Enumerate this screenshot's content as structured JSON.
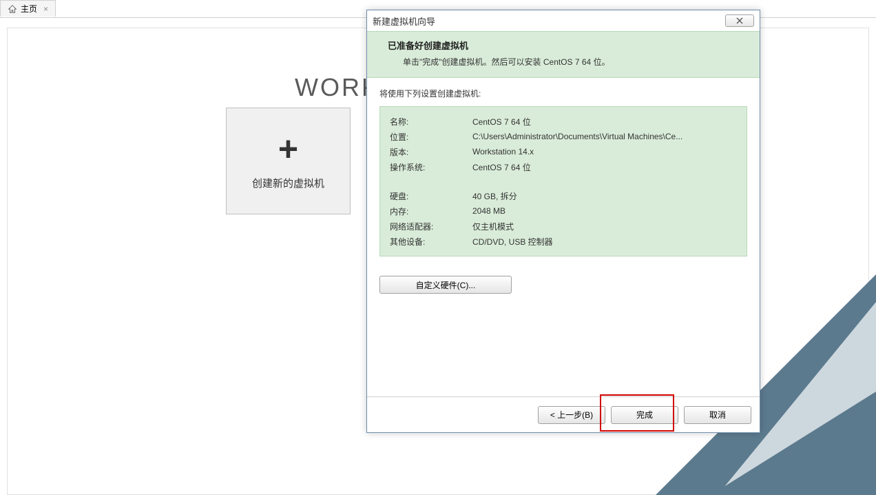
{
  "tab": {
    "label": "主页",
    "close": "×"
  },
  "background": {
    "workstation_partial": "WORK",
    "tile": {
      "plus": "+",
      "label": "创建新的虚拟机"
    }
  },
  "dialog": {
    "title": "新建虚拟机向导",
    "header_title": "已准备好创建虚拟机",
    "header_sub": "单击\"完成\"创建虚拟机。然后可以安装 CentOS 7 64 位。",
    "intro": "将使用下列设置创建虚拟机:",
    "settings": {
      "name_label": "名称:",
      "name_value": "CentOS 7 64 位",
      "location_label": "位置:",
      "location_value": "C:\\Users\\Administrator\\Documents\\Virtual Machines\\Ce...",
      "version_label": "版本:",
      "version_value": "Workstation 14.x",
      "os_label": "操作系统:",
      "os_value": "CentOS 7 64 位",
      "disk_label": "硬盘:",
      "disk_value": "40 GB, 拆分",
      "memory_label": "内存:",
      "memory_value": "2048 MB",
      "network_label": "网络适配器:",
      "network_value": "仅主机模式",
      "other_label": "其他设备:",
      "other_value": "CD/DVD, USB 控制器"
    },
    "customize_button": "自定义硬件(C)...",
    "footer": {
      "back": "< 上一步(B)",
      "finish": "完成",
      "cancel": "取消"
    }
  }
}
